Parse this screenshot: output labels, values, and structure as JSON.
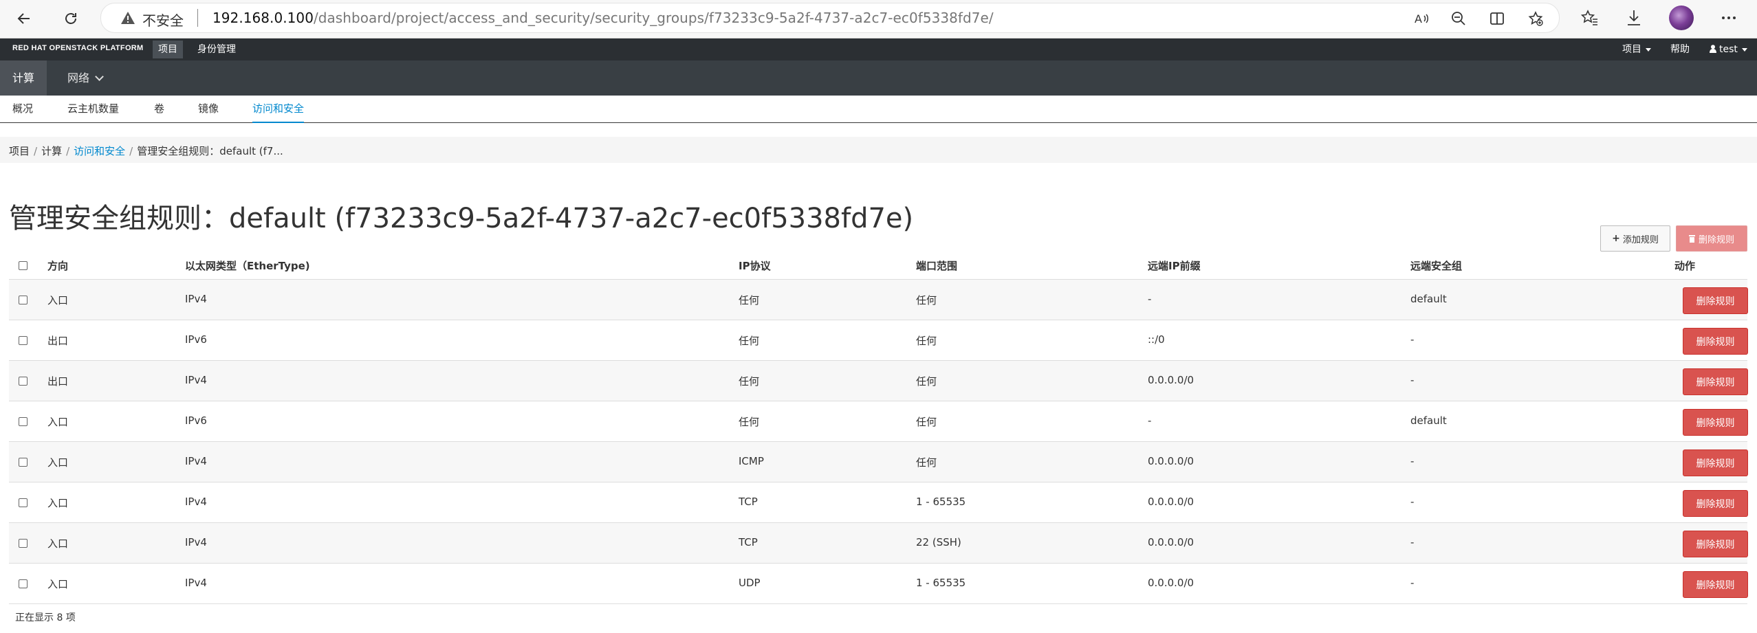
{
  "browser": {
    "insecure_label": "不安全",
    "url_host": "192.168.0.100",
    "url_path": "/dashboard/project/access_and_security/security_groups/f73233c9-5a2f-4737-a2c7-ec0f5338fd7e/"
  },
  "topbar": {
    "brand": "RED HAT OPENSTACK PLATFORM",
    "tabs": [
      "项目",
      "身份管理"
    ],
    "right_project": "项目",
    "right_help": "帮助",
    "right_user": "test"
  },
  "secondbar": {
    "items": [
      "计算",
      "网络"
    ]
  },
  "thirdbar": {
    "items": [
      "概况",
      "云主机数量",
      "卷",
      "镜像",
      "访问和安全"
    ]
  },
  "breadcrumb": [
    "项目",
    "计算",
    "访问和安全",
    "管理安全组规则：default (f7..."
  ],
  "page_title": "管理安全组规则：default (f73233c9-5a2f-4737-a2c7-ec0f5338fd7e)",
  "actions": {
    "add_rule": "添加规则",
    "delete_rules": "删除规则"
  },
  "table": {
    "headers": [
      "方向",
      "以太网类型（EtherType)",
      "IP协议",
      "端口范围",
      "远端IP前缀",
      "远端安全组",
      "动作"
    ],
    "rows": [
      {
        "direction": "入口",
        "ethertype": "IPv4",
        "protocol": "任何",
        "port_range": "任何",
        "remote_ip": "-",
        "remote_group": "default",
        "action": "删除规则"
      },
      {
        "direction": "出口",
        "ethertype": "IPv6",
        "protocol": "任何",
        "port_range": "任何",
        "remote_ip": "::/0",
        "remote_group": "-",
        "action": "删除规则"
      },
      {
        "direction": "出口",
        "ethertype": "IPv4",
        "protocol": "任何",
        "port_range": "任何",
        "remote_ip": "0.0.0.0/0",
        "remote_group": "-",
        "action": "删除规则"
      },
      {
        "direction": "入口",
        "ethertype": "IPv6",
        "protocol": "任何",
        "port_range": "任何",
        "remote_ip": "-",
        "remote_group": "default",
        "action": "删除规则"
      },
      {
        "direction": "入口",
        "ethertype": "IPv4",
        "protocol": "ICMP",
        "port_range": "任何",
        "remote_ip": "0.0.0.0/0",
        "remote_group": "-",
        "action": "删除规则"
      },
      {
        "direction": "入口",
        "ethertype": "IPv4",
        "protocol": "TCP",
        "port_range": "1 - 65535",
        "remote_ip": "0.0.0.0/0",
        "remote_group": "-",
        "action": "删除规则"
      },
      {
        "direction": "入口",
        "ethertype": "IPv4",
        "protocol": "TCP",
        "port_range": "22 (SSH)",
        "remote_ip": "0.0.0.0/0",
        "remote_group": "-",
        "action": "删除规则"
      },
      {
        "direction": "入口",
        "ethertype": "IPv4",
        "protocol": "UDP",
        "port_range": "1 - 65535",
        "remote_ip": "0.0.0.0/0",
        "remote_group": "-",
        "action": "删除规则"
      }
    ],
    "footer": "正在显示 8 项"
  },
  "colors": {
    "danger": "#d9534f",
    "link": "#0088ce",
    "topbar": "#2b2f33",
    "secondbar": "#393f44"
  }
}
